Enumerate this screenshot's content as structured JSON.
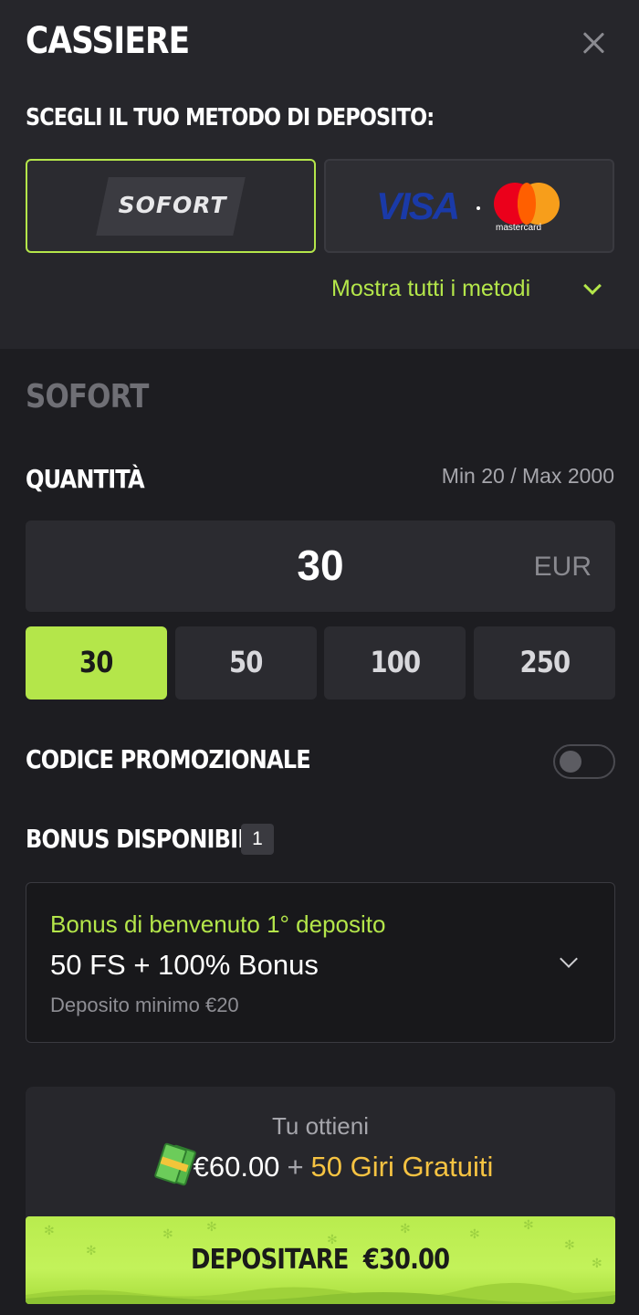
{
  "header": {
    "title": "CASSIERE",
    "close_icon": "close-icon"
  },
  "methods": {
    "heading": "SCEGLI IL TUO METODO DI DEPOSITO:",
    "items": [
      {
        "label": "SOFORT",
        "selected": true
      },
      {
        "label_visa": "VISA",
        "label_mc": "mastercard",
        "selected": false
      }
    ],
    "show_all_label": "Mostra tutti i metodi",
    "show_all_icon": "chevron-down-icon"
  },
  "form": {
    "method_name": "SOFORT",
    "quantity_label": "QUANTITÀ",
    "min_max": "Min 20 / Max 2000",
    "amount_value": "30",
    "currency": "EUR",
    "presets": [
      {
        "label": "30",
        "active": true
      },
      {
        "label": "50",
        "active": false
      },
      {
        "label": "100",
        "active": false
      },
      {
        "label": "250",
        "active": false
      }
    ],
    "promo_label": "CODICE PROMOZIONALE",
    "promo_enabled": false
  },
  "bonus": {
    "heading": "BONUS DISPONIBILI",
    "count": "1",
    "card": {
      "type": "Bonus di benvenuto 1° deposito",
      "title": "50 FS + 100% Bonus",
      "min_deposit": "Deposito minimo €20"
    }
  },
  "summary": {
    "label": "Tu ottieni",
    "money_icon": "money-icon",
    "amount": "€60.00",
    "plus": "+",
    "free_spins": "50 Giri Gratuiti"
  },
  "deposit_button": {
    "label": "DEPOSITARE",
    "amount": "€30.00"
  },
  "colors": {
    "accent": "#b4e64a",
    "background": "#1d1d21",
    "panel": "#26262b",
    "gold": "#f6c342"
  }
}
